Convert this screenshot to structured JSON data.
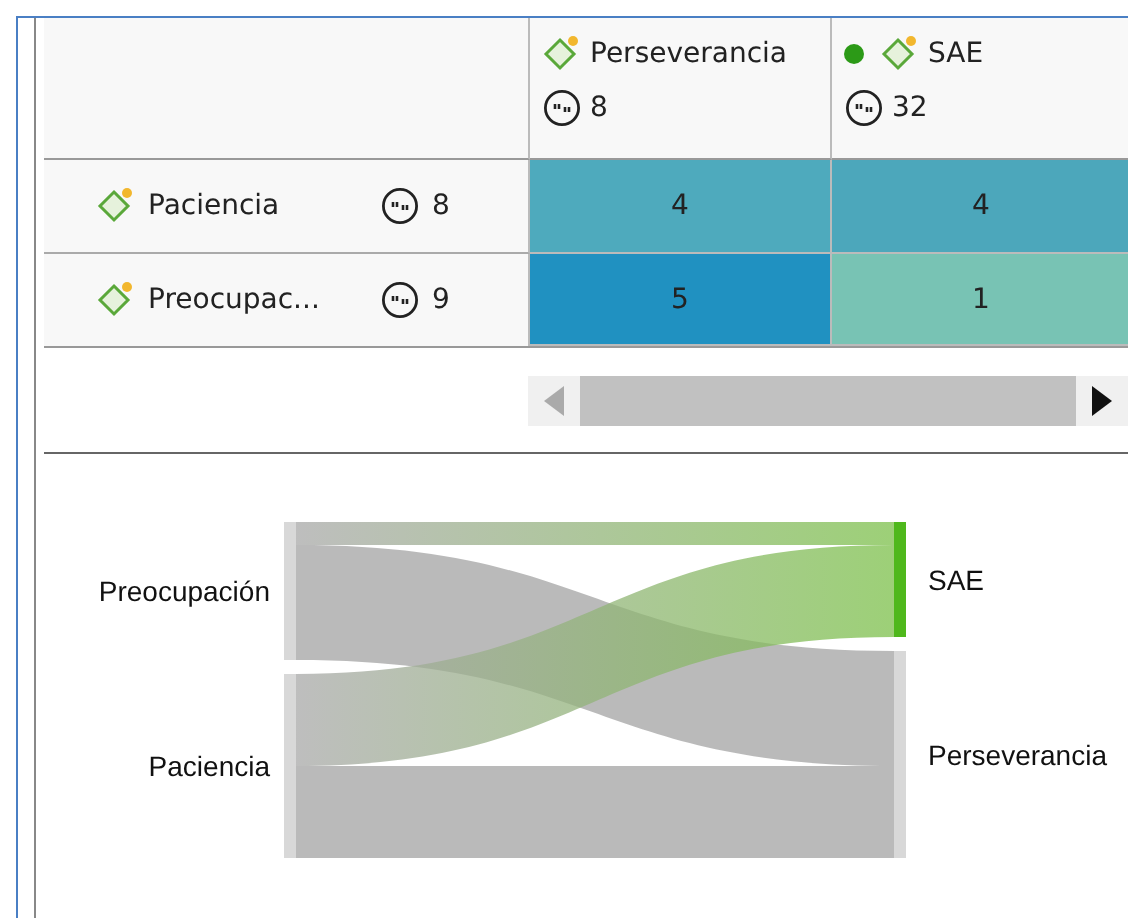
{
  "table": {
    "columns": [
      {
        "label": "Perseverancia",
        "count": "8",
        "dot": false
      },
      {
        "label": "SAE",
        "count": "32",
        "dot": true
      }
    ],
    "rows": [
      {
        "label": "Paciencia",
        "count": "8",
        "cells": [
          {
            "value": "4",
            "color": "#4eaabd"
          },
          {
            "value": "4",
            "color": "#4ca7bb"
          }
        ]
      },
      {
        "label": "Preocupac...",
        "count": "9",
        "cells": [
          {
            "value": "5",
            "color": "#2091c1"
          },
          {
            "value": "1",
            "color": "#78c3b4"
          }
        ]
      }
    ]
  },
  "sankey": {
    "left": [
      {
        "label": "Preocupación"
      },
      {
        "label": "Paciencia"
      }
    ],
    "right": [
      {
        "label": "SAE",
        "highlighted": true
      },
      {
        "label": "Perseverancia",
        "highlighted": false
      }
    ]
  }
}
